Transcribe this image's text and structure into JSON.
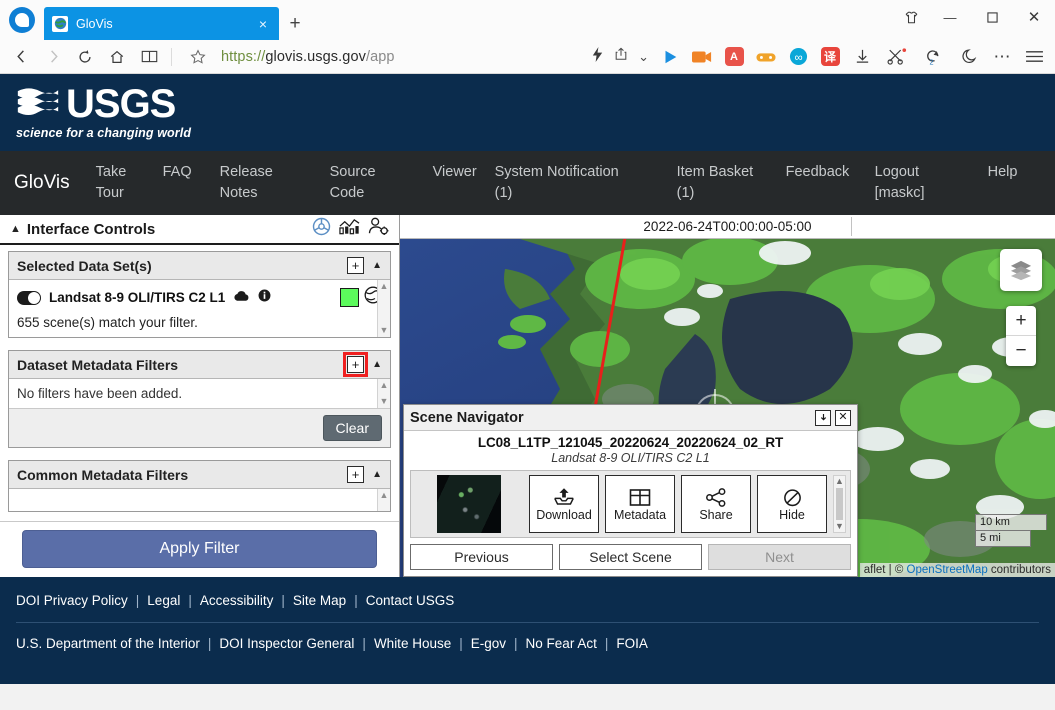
{
  "browser": {
    "tab": {
      "title": "GloVis",
      "favicon": "globe-icon",
      "close": "×"
    },
    "newtab_label": "+",
    "window": {
      "theme": "shirt-icon",
      "minimize": "—",
      "maximize": "▢",
      "close": "✕"
    },
    "nav": {
      "back": "‹",
      "forward": "›",
      "reload": "⟳",
      "home": "⌂",
      "reader": "▥",
      "bookmark": "☆",
      "url_scheme": "https://",
      "url_host": "glovis.usgs.gov",
      "url_path": "/app",
      "url_full": "https://glovis.usgs.gov/app",
      "lightning": "⚡",
      "share": "↗",
      "chevron": "⌄"
    },
    "extensions": [
      {
        "name": "video-play-icon",
        "glyph": "▶",
        "color": "#1b8fe0"
      },
      {
        "name": "video-recorder-icon",
        "glyph": "■",
        "color": "#f08326"
      },
      {
        "name": "adblock-icon",
        "glyph": "A",
        "color": "#e8534a"
      },
      {
        "name": "game-controller-icon",
        "glyph": "⬤",
        "color": "#f0a32a"
      },
      {
        "name": "infinity-icon",
        "glyph": "∞",
        "color": "#0aa7d8"
      },
      {
        "name": "translate-icon",
        "glyph": "译",
        "color": "#e8453c"
      },
      {
        "name": "download-icon",
        "glyph": "↓",
        "color": "#3a3a3a"
      },
      {
        "name": "scissors-icon",
        "glyph": "✂",
        "color": "#3a3a3a"
      },
      {
        "name": "history-icon",
        "glyph": "↺",
        "color": "#3a3a3a"
      },
      {
        "name": "dark-mode-icon",
        "glyph": "☾",
        "color": "#3a3a3a"
      },
      {
        "name": "more-icon",
        "glyph": "⋯",
        "color": "#3a3a3a"
      },
      {
        "name": "menu-icon",
        "glyph": "☰",
        "color": "#3a3a3a"
      }
    ]
  },
  "usgs": {
    "wordmark": "USGS",
    "tagline": "science for a changing world"
  },
  "glovis_nav": {
    "brand": "GloVis",
    "items": [
      {
        "line1": "Take",
        "line2": "Tour"
      },
      {
        "line1": "FAQ",
        "line2": ""
      },
      {
        "line1": "Release",
        "line2": "Notes"
      },
      {
        "line1": "Source",
        "line2": "Code"
      },
      {
        "line1": "Viewer",
        "line2": ""
      },
      {
        "line1": "System Notification",
        "line2": "(1)"
      },
      {
        "line1": "Item Basket",
        "line2": "(1)"
      },
      {
        "line1": "Feedback",
        "line2": ""
      },
      {
        "line1": "Logout",
        "line2": "[maskc]"
      },
      {
        "line1": "Help",
        "line2": ""
      }
    ]
  },
  "sidebar": {
    "header": {
      "title": "Interface Controls",
      "collapse_caret": "▲",
      "icons": [
        "steering-wheel-icon",
        "bar-chart-icon",
        "user-settings-icon"
      ]
    },
    "selected_data_sets": {
      "title": "Selected Data Set(s)",
      "add_button": "+",
      "collapse_caret": "▲",
      "dataset": {
        "name": "Landsat 8-9 OLI/TIRS C2 L1",
        "cloud_icon": "cloud-icon",
        "info_icon": "info-icon",
        "swatch_color": "#5cfa5c",
        "globe_icon": "globe-icon"
      },
      "match_note": "655 scene(s) match your filter."
    },
    "dataset_metadata_filters": {
      "title": "Dataset Metadata Filters",
      "add_button": "+",
      "add_button_highlighted": true,
      "collapse_caret": "▲",
      "empty_text": "No filters have been added.",
      "clear_label": "Clear"
    },
    "common_metadata_filters": {
      "title": "Common Metadata Filters",
      "add_button": "+",
      "collapse_caret": "▲"
    },
    "apply_filter_label": "Apply Filter"
  },
  "map": {
    "date_label": "2022-06-24T00:00:00-05:00",
    "layers_icon": "layers-icon",
    "zoom_in": "+",
    "zoom_out": "−",
    "scale": {
      "metric": "10 km",
      "imperial": "5 mi"
    },
    "attribution_prefix": "aflet | © ",
    "attribution_link": "OpenStreetMap",
    "attribution_suffix": " contributors"
  },
  "scene_navigator": {
    "title": "Scene Navigator",
    "detach_icon": "detach-icon",
    "close_icon": "close-icon",
    "scene_id": "LC08_L1TP_121045_20220624_20220624_02_RT",
    "dataset_label": "Landsat 8-9 OLI/TIRS C2 L1",
    "thumbnail": "scene-thumbnail",
    "actions": [
      {
        "label": "Download",
        "icon": "download-icon"
      },
      {
        "label": "Metadata",
        "icon": "grid-icon"
      },
      {
        "label": "Share",
        "icon": "share-icon"
      },
      {
        "label": "Hide",
        "icon": "no-entry-icon"
      }
    ],
    "footer": [
      {
        "label": "Previous",
        "disabled": false
      },
      {
        "label": "Select Scene",
        "disabled": false
      },
      {
        "label": "Next",
        "disabled": true
      }
    ]
  },
  "footer": {
    "row1": [
      "DOI Privacy Policy",
      "Legal",
      "Accessibility",
      "Site Map",
      "Contact USGS"
    ],
    "row2": [
      "U.S. Department of the Interior",
      "DOI Inspector General",
      "White House",
      "E-gov",
      "No Fear Act",
      "FOIA"
    ],
    "separator": "|"
  }
}
